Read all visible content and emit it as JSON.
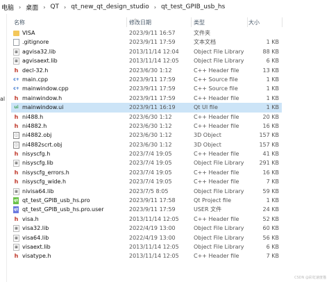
{
  "breadcrumb": {
    "items": [
      "电脑",
      "桌面",
      "QT",
      "qt_new_qt_design_studio",
      "qt_test_GPIB_usb_hs"
    ],
    "separator": "›"
  },
  "left_pane": {
    "fragments": [
      "al"
    ]
  },
  "columns": {
    "name": "名称",
    "date": "修改日期",
    "type": "类型",
    "size": "大小"
  },
  "files": [
    {
      "name": "VISA",
      "date": "2023/9/11 16:57",
      "type": "文件夹",
      "size": "",
      "icon": "folder-icon"
    },
    {
      "name": ".gitignore",
      "date": "2023/9/11 17:59",
      "type": "文本文档",
      "size": "1 KB",
      "icon": "text-file-icon"
    },
    {
      "name": "agvisa32.lib",
      "date": "2013/11/14 12:04",
      "type": "Object File Library",
      "size": "88 KB",
      "icon": "lib-file-icon"
    },
    {
      "name": "agvisaext.lib",
      "date": "2013/11/14 12:05",
      "type": "Object File Library",
      "size": "6 KB",
      "icon": "lib-file-icon"
    },
    {
      "name": "decl-32.h",
      "date": "2023/6/30 1:12",
      "type": "C++ Header file",
      "size": "13 KB",
      "icon": "header-file-icon"
    },
    {
      "name": "main.cpp",
      "date": "2023/9/11 17:59",
      "type": "C++ Source file",
      "size": "1 KB",
      "icon": "cpp-file-icon"
    },
    {
      "name": "mainwindow.cpp",
      "date": "2023/9/11 17:59",
      "type": "C++ Source file",
      "size": "1 KB",
      "icon": "cpp-file-icon"
    },
    {
      "name": "mainwindow.h",
      "date": "2023/9/11 17:59",
      "type": "C++ Header file",
      "size": "1 KB",
      "icon": "header-file-icon"
    },
    {
      "name": "mainwindow.ui",
      "date": "2023/9/11 16:19",
      "type": "Qt UI file",
      "size": "1 KB",
      "icon": "ui-file-icon"
    },
    {
      "name": "ni488.h",
      "date": "2023/6/30 1:12",
      "type": "C++ Header file",
      "size": "20 KB",
      "icon": "header-file-icon"
    },
    {
      "name": "ni4882.h",
      "date": "2023/6/30 1:12",
      "type": "C++ Header file",
      "size": "16 KB",
      "icon": "header-file-icon"
    },
    {
      "name": "ni4882.obj",
      "date": "2023/6/30 1:12",
      "type": "3D Object",
      "size": "157 KB",
      "icon": "object-file-icon"
    },
    {
      "name": "ni4882scrt.obj",
      "date": "2023/6/30 1:12",
      "type": "3D Object",
      "size": "157 KB",
      "icon": "object-file-icon"
    },
    {
      "name": "nisyscfg.h",
      "date": "2023/7/4 19:05",
      "type": "C++ Header file",
      "size": "41 KB",
      "icon": "header-file-icon"
    },
    {
      "name": "nisyscfg.lib",
      "date": "2023/7/4 19:05",
      "type": "Object File Library",
      "size": "291 KB",
      "icon": "lib-file-icon"
    },
    {
      "name": "nisyscfg_errors.h",
      "date": "2023/7/4 19:05",
      "type": "C++ Header file",
      "size": "16 KB",
      "icon": "header-file-icon"
    },
    {
      "name": "nisyscfg_wide.h",
      "date": "2023/7/4 19:05",
      "type": "C++ Header file",
      "size": "7 KB",
      "icon": "header-file-icon"
    },
    {
      "name": "nivisa64.lib",
      "date": "2023/7/5 8:05",
      "type": "Object File Library",
      "size": "59 KB",
      "icon": "lib-file-icon"
    },
    {
      "name": "qt_test_GPIB_usb_hs.pro",
      "date": "2023/9/11 17:58",
      "type": "Qt Project file",
      "size": "1 KB",
      "icon": "qt-project-icon"
    },
    {
      "name": "qt_test_GPIB_usb_hs.pro.user",
      "date": "2023/9/11 17:59",
      "type": "USER 文件",
      "size": "24 KB",
      "icon": "qt-project-user-icon"
    },
    {
      "name": "visa.h",
      "date": "2013/11/14 12:05",
      "type": "C++ Header file",
      "size": "52 KB",
      "icon": "header-file-icon"
    },
    {
      "name": "visa32.lib",
      "date": "2022/4/19 13:00",
      "type": "Object File Library",
      "size": "60 KB",
      "icon": "lib-file-icon"
    },
    {
      "name": "visa64.lib",
      "date": "2022/4/19 13:00",
      "type": "Object File Library",
      "size": "56 KB",
      "icon": "lib-file-icon"
    },
    {
      "name": "visaext.lib",
      "date": "2013/11/14 12:05",
      "type": "Object File Library",
      "size": "6 KB",
      "icon": "lib-file-icon"
    },
    {
      "name": "visatype.h",
      "date": "2013/11/14 12:05",
      "type": "C++ Header file",
      "size": "7 KB",
      "icon": "header-file-icon"
    }
  ],
  "selected_index": 8,
  "watermark": "CSDN @彩虹速度猫",
  "colors": {
    "selected_row": "#cce4f7",
    "folder": "#f3c75a",
    "header_icon": "#c0392b"
  }
}
